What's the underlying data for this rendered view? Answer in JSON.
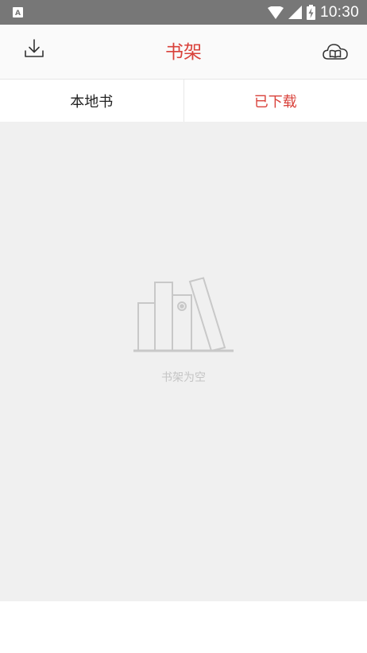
{
  "status_bar": {
    "time": "10:30",
    "left_icon": "a-letter-notification-icon",
    "icons": [
      "wifi-icon",
      "cell-signal-icon",
      "battery-charging-icon"
    ]
  },
  "header": {
    "title": "书架",
    "left_icon": "download-icon",
    "right_icon": "cloud-book-icon",
    "accent_color": "#d9413a"
  },
  "tabs": [
    {
      "label": "本地书",
      "active": false
    },
    {
      "label": "已下载",
      "active": true
    }
  ],
  "empty_state": {
    "icon": "bookshelf-icon",
    "message": "书架为空"
  }
}
